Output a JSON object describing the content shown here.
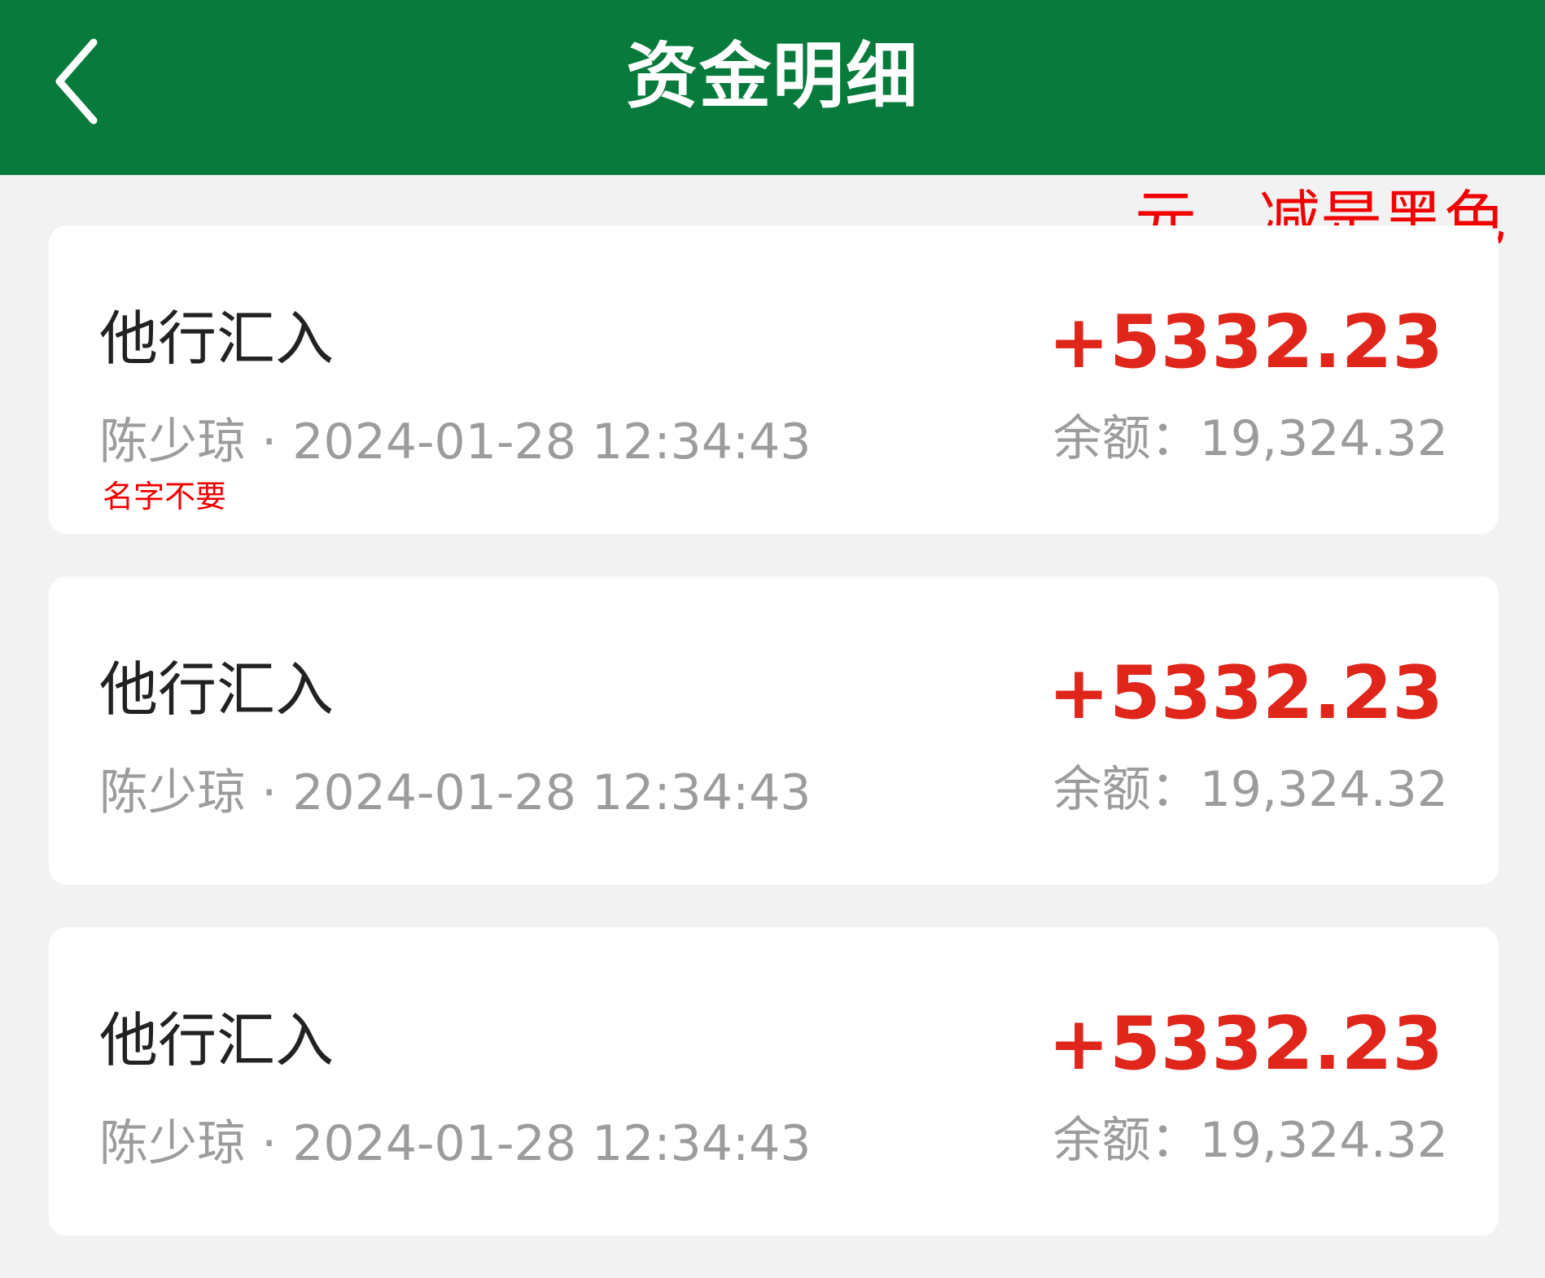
{
  "header": {
    "title": "资金明细",
    "back_icon": "chevron-left-icon",
    "background": "#077a3c"
  },
  "annotations": {
    "top_right": "元，减是黑色",
    "name_note": "名字不要",
    "color": "#f20000"
  },
  "transactions": [
    {
      "title": "他行汇入",
      "meta": "陈少琼 · 2024-01-28 12:34:43",
      "amount": "+5332.23",
      "balance": "余额：19,324.32"
    },
    {
      "title": "他行汇入",
      "meta": "陈少琼 · 2024-01-28 12:34:43",
      "amount": "+5332.23",
      "balance": "余额：19,324.32"
    },
    {
      "title": "他行汇入",
      "meta": "陈少琼 · 2024-01-28 12:34:43",
      "amount": "+5332.23",
      "balance": "余额：19,324.32"
    }
  ],
  "colors": {
    "amount_positive": "#e0251b",
    "secondary_text": "#9c9c9c",
    "primary_text": "#222222"
  }
}
